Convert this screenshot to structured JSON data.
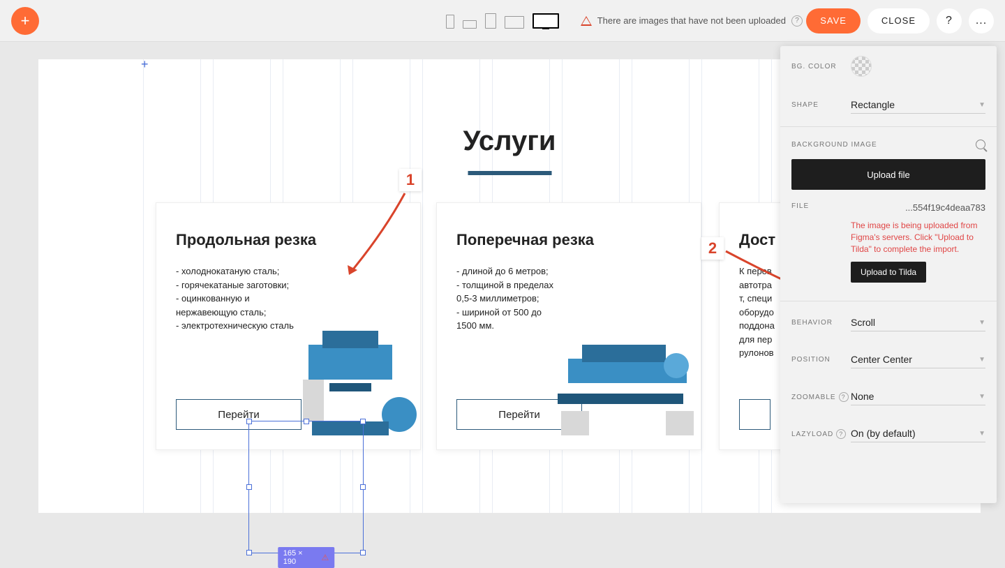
{
  "toolbar": {
    "warning_text": "There are images that have not been uploaded",
    "save_label": "SAVE",
    "close_label": "CLOSE",
    "help_label": "?",
    "more_label": "..."
  },
  "canvas": {
    "title": "Услуги",
    "cards": [
      {
        "title": "Продольная резка",
        "desc": "- холоднокатаную сталь;\n- горячекатаные заготовки;\n- оцинкованную и\nнержавеющую сталь;\n- электротехническую сталь",
        "btn": "Перейти"
      },
      {
        "title": "Поперечная резка",
        "desc": "- длиной до 6 метров;\n- толщиной в пределах\n0,5-3 миллиметров;\n- шириной от 500 до\n1500 мм.",
        "btn": "Перейти"
      },
      {
        "title": "Дост",
        "desc": "К перев\nавтотра\nт, специ\nоборудо\nподдона\nдля пер\nрулонов",
        "btn": ""
      }
    ],
    "selected_size": "165 × 190"
  },
  "annotations": {
    "one": "1",
    "two": "2"
  },
  "panel": {
    "bgcolor_label": "BG. COLOR",
    "shape_label": "SHAPE",
    "shape_value": "Rectangle",
    "bgimage_label": "BACKGROUND IMAGE",
    "upload_label": "Upload file",
    "file_label": "FILE",
    "file_value": "...554f19c4deaa783",
    "import_note": "The image is being uploaded from Figma's servers. Click \"Upload to Tilda\" to complete the import.",
    "upload_tilda_label": "Upload to Tilda",
    "behavior_label": "BEHAVIOR",
    "behavior_value": "Scroll",
    "position_label": "POSITION",
    "position_value": "Center Center",
    "zoomable_label": "ZOOMABLE",
    "zoomable_value": "None",
    "lazyload_label": "LAZYLOAD",
    "lazyload_value": "On (by default)"
  }
}
